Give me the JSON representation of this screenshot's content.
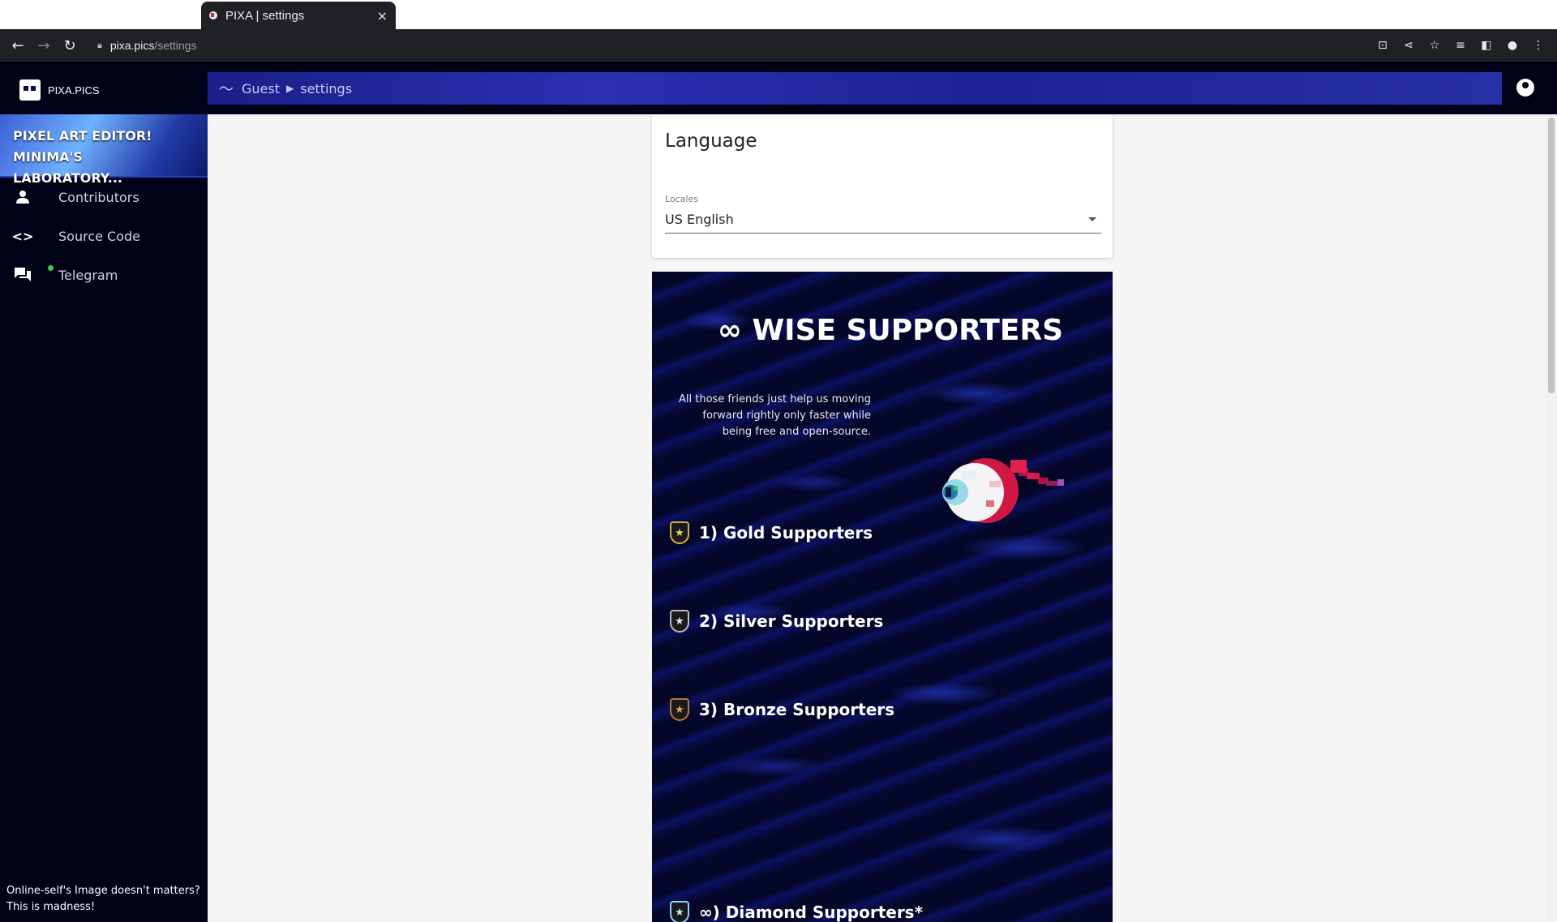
{
  "browser": {
    "tab_title": "PIXA | settings",
    "tab_close": "×",
    "url_host": "pixa.pics",
    "url_path": "/settings"
  },
  "app": {
    "brand": "PIXA.PICS",
    "breadcrumb": {
      "user": "Guest",
      "page": "settings"
    }
  },
  "sidebar": {
    "promo_line1": "PIXEL ART EDITOR!",
    "promo_line2": "MINIMA'S LABORATORY...",
    "items": [
      {
        "label": "Contributors",
        "icon": "person-icon"
      },
      {
        "label": "Source Code",
        "icon": "code-icon"
      },
      {
        "label": "Telegram",
        "icon": "chat-icon",
        "online": true
      }
    ],
    "footnote": "Online-self's Image doesn't matters? This is madness!"
  },
  "language": {
    "heading": "Language",
    "field_label": "Locales",
    "selected": "US English"
  },
  "supporters": {
    "title": "WISE SUPPORTERS",
    "title_symbol": "∞",
    "description": "All those friends just help us moving forward rightly only faster while being free and open-source.",
    "tiers": [
      {
        "label": "1) Gold Supporters",
        "level": "gold"
      },
      {
        "label": "2) Silver Supporters",
        "level": "silver"
      },
      {
        "label": "3) Bronze Supporters",
        "level": "bronze"
      },
      {
        "label": "∞) Diamond Supporters*",
        "level": "diamond"
      }
    ]
  },
  "colors": {
    "appbar": "#000318",
    "crumbbar": "#2a30b0",
    "online_dot": "#3fd13f"
  }
}
